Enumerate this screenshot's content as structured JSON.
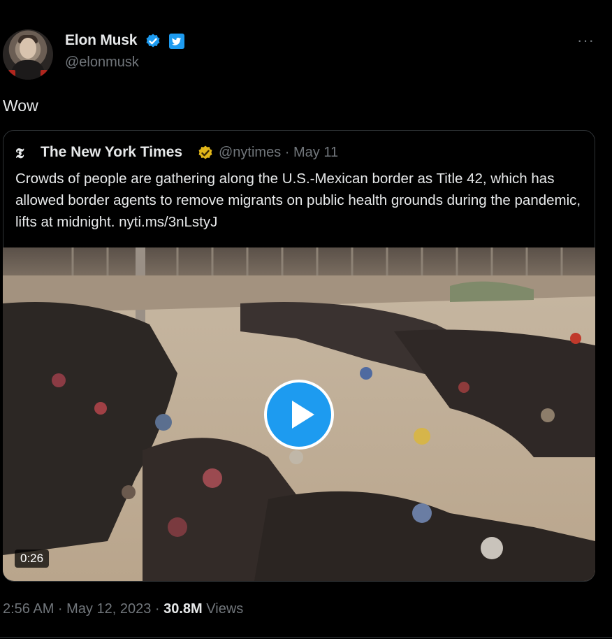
{
  "author": {
    "display_name": "Elon Musk",
    "handle": "@elonmusk",
    "verified_badge_color": "#1d9bf0"
  },
  "tweet": {
    "text": "Wow",
    "more_label": "···"
  },
  "quoted": {
    "logo_glyph": "𝕿",
    "display_name": "The New York Times",
    "handle_date": "@nytimes · May 11",
    "verified_badge_color": "#e2b719",
    "text": "Crowds of people are gathering along the U.S.-Mexican border as Title 42, which has allowed border agents to remove migrants on public health grounds during the pandemic, lifts at midnight. nyti.ms/3nLstyJ",
    "video": {
      "duration": "0:26",
      "play_icon": "play-icon"
    }
  },
  "meta": {
    "timestamp": "2:56 AM · May 12, 2023 · ",
    "views_count": "30.8M",
    "views_label": " Views"
  },
  "colors": {
    "background": "#000000",
    "text_primary": "#e7e9ea",
    "text_secondary": "#71767b",
    "accent": "#1d9bf0",
    "border": "#2f3336"
  }
}
